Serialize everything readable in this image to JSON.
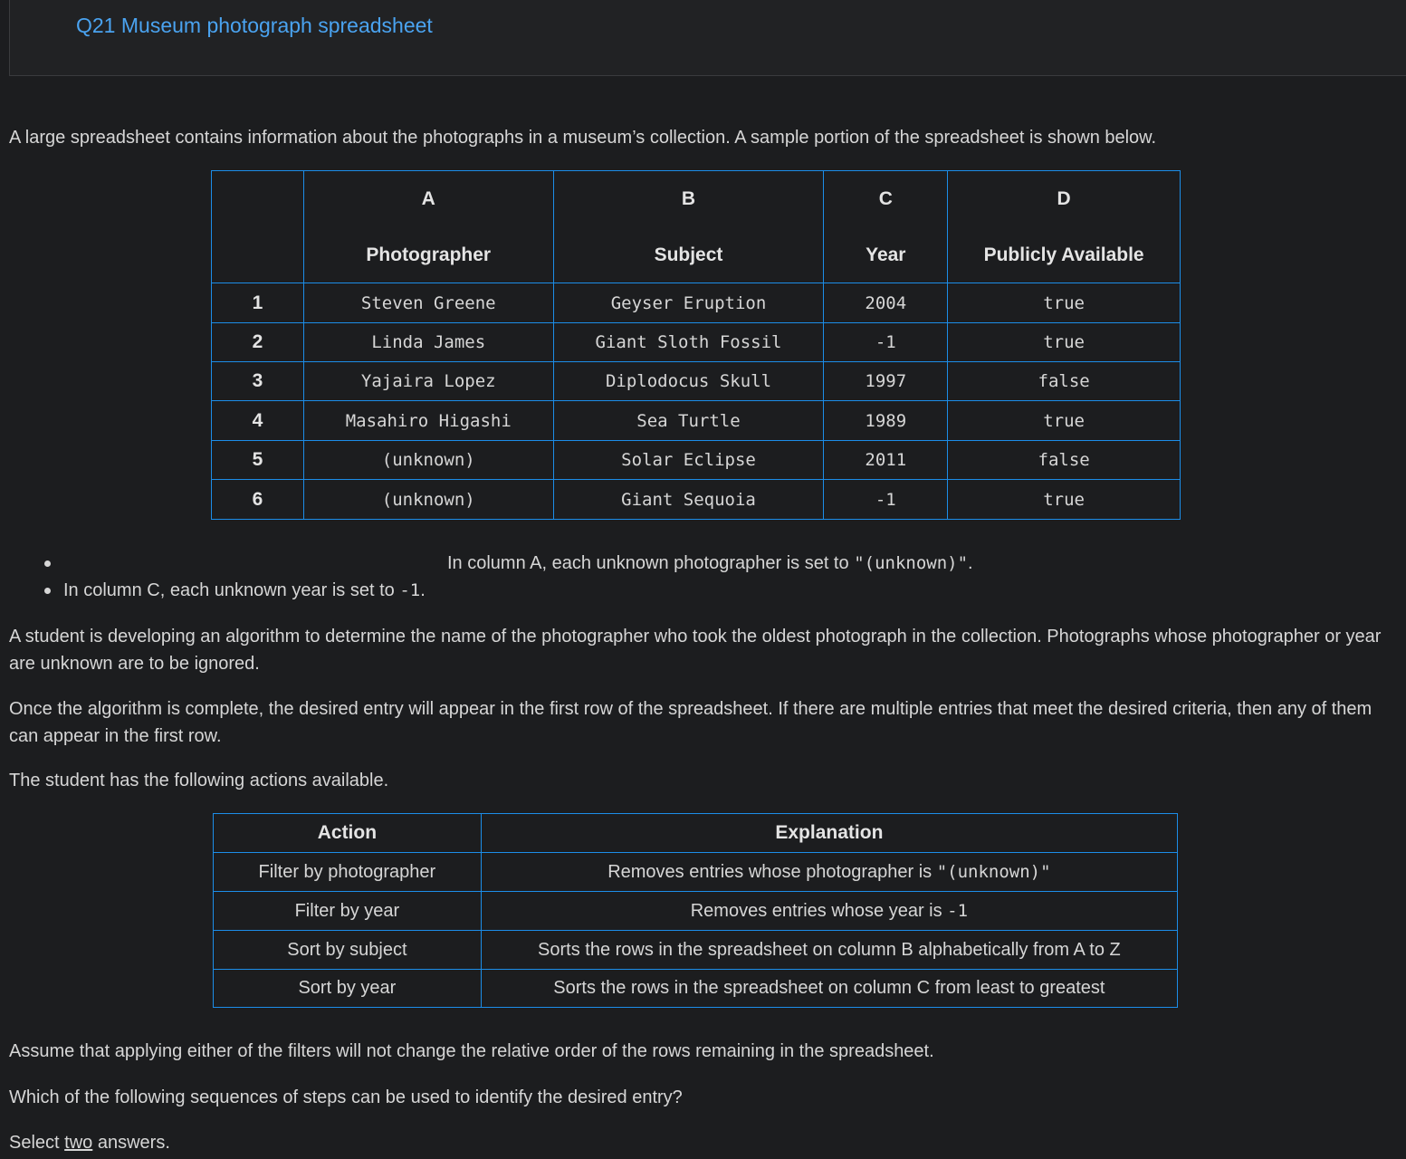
{
  "title": "Q21 Museum photograph spreadsheet",
  "intro": "A large spreadsheet contains information about the photographs in a museum’s collection. A sample portion of the spreadsheet is shown below.",
  "sheet": {
    "letters": [
      "A",
      "B",
      "C",
      "D"
    ],
    "headers": [
      "Photographer",
      "Subject",
      "Year",
      "Publicly Available"
    ],
    "rows": [
      {
        "n": "1",
        "a": "Steven Greene",
        "b": "Geyser Eruption",
        "c": "2004",
        "d": "true"
      },
      {
        "n": "2",
        "a": "Linda James",
        "b": "Giant Sloth Fossil",
        "c": "-1",
        "d": "true"
      },
      {
        "n": "3",
        "a": "Yajaira Lopez",
        "b": "Diplodocus Skull",
        "c": "1997",
        "d": "false"
      },
      {
        "n": "4",
        "a": "Masahiro Higashi",
        "b": "Sea Turtle",
        "c": "1989",
        "d": "true"
      },
      {
        "n": "5",
        "a": "(unknown)",
        "b": "Solar Eclipse",
        "c": "2011",
        "d": "false"
      },
      {
        "n": "6",
        "a": "(unknown)",
        "b": "Giant Sequoia",
        "c": "-1",
        "d": "true"
      }
    ]
  },
  "notes": [
    {
      "text": "In column A, each unknown photographer is set to",
      "code": "\"(unknown)\"",
      "tail": "."
    },
    {
      "text": "In column C, each unknown year is set to",
      "code": "-1",
      "tail": "."
    }
  ],
  "para1": "A student is developing an algorithm to determine the name of the photographer who took the oldest photograph in the collection. Photographs whose photographer or year are unknown are to be ignored.",
  "para2": "Once the algorithm is complete, the desired entry will appear in the first row of the spreadsheet. If there are multiple entries that meet the desired criteria, then any of them can appear in the first row.",
  "para3": "The student has the following actions available.",
  "actions": {
    "headers": [
      "Action",
      "Explanation"
    ],
    "rows": [
      {
        "action": "Filter by photographer",
        "explanation": "Removes entries whose photographer is",
        "code": "\"(unknown)\""
      },
      {
        "action": "Filter by year",
        "explanation": "Removes entries whose year is",
        "code": "-1"
      },
      {
        "action": "Sort by subject",
        "explanation": "Sorts the rows in the spreadsheet on column B alphabetically from A to Z",
        "code": ""
      },
      {
        "action": "Sort by year",
        "explanation": "Sorts the rows in the spreadsheet on column C from least to greatest",
        "code": ""
      }
    ]
  },
  "para4": "Assume that applying either of the filters will not change the relative order of the rows remaining in the spreadsheet.",
  "para5": "Which of the following sequences of steps can be used to identify the desired entry?",
  "select": {
    "pre": "Select",
    "word": "two",
    "post": "answers."
  }
}
